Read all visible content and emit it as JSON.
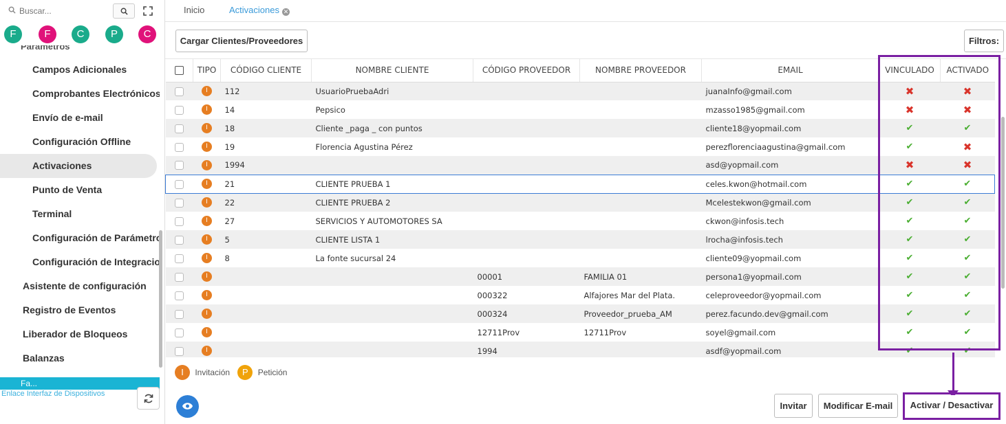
{
  "sidebar": {
    "search_placeholder": "Buscar...",
    "circles": [
      {
        "letter": "F",
        "color": "#1aab8b"
      },
      {
        "letter": "F",
        "color": "#e0127a"
      },
      {
        "letter": "C",
        "color": "#1aab8b"
      },
      {
        "letter": "P",
        "color": "#1aab8b"
      },
      {
        "letter": "C",
        "color": "#e0127a"
      }
    ],
    "section_partial": "Parámetros",
    "items": [
      {
        "label": "Campos Adicionales",
        "level": "sub"
      },
      {
        "label": "Comprobantes Electrónicos",
        "level": "sub"
      },
      {
        "label": "Envío de e-mail",
        "level": "sub"
      },
      {
        "label": "Configuración Offline",
        "level": "sub"
      },
      {
        "label": "Activaciones",
        "level": "sub",
        "active": true
      },
      {
        "label": "Punto de Venta",
        "level": "sub"
      },
      {
        "label": "Terminal",
        "level": "sub"
      },
      {
        "label": "Configuración de Parámetros",
        "level": "sub"
      },
      {
        "label": "Configuración de Integraciones",
        "level": "sub"
      },
      {
        "label": "Asistente de configuración",
        "level": "top"
      },
      {
        "label": "Registro de Eventos",
        "level": "top"
      },
      {
        "label": "Liberador de Bloqueos",
        "level": "top"
      },
      {
        "label": "Balanzas",
        "level": "top"
      }
    ],
    "footer_partial": "Fa...",
    "device_link": "Enlace Interfaz de Dispositivos"
  },
  "tabs": [
    {
      "label": "Inicio"
    },
    {
      "label": "Activaciones",
      "closable": true
    }
  ],
  "toolbar": {
    "cargar_label": "Cargar Clientes/Proveedores",
    "filtros_label": "Filtros:"
  },
  "table": {
    "headers": [
      "",
      "TIPO",
      "CÓDIGO CLIENTE",
      "NOMBRE CLIENTE",
      "CÓDIGO PROVEEDOR",
      "NOMBRE PROVEEDOR",
      "EMAIL",
      "VINCULADO",
      "ACTIVADO"
    ],
    "rows": [
      {
        "tipo": "I",
        "codigo_cliente": "112",
        "nombre_cliente": "UsuarioPruebaAdri",
        "codigo_proveedor": "",
        "nombre_proveedor": "",
        "email": "juanaInfo@gmail.com",
        "vinculado": false,
        "activado": false
      },
      {
        "tipo": "I",
        "codigo_cliente": "14",
        "nombre_cliente": "Pepsico",
        "codigo_proveedor": "",
        "nombre_proveedor": "",
        "email": "mzasso1985@gmail.com",
        "vinculado": false,
        "activado": false
      },
      {
        "tipo": "I",
        "codigo_cliente": "18",
        "nombre_cliente": "Cliente _paga _ con puntos",
        "codigo_proveedor": "",
        "nombre_proveedor": "",
        "email": "cliente18@yopmail.com",
        "vinculado": true,
        "activado": true
      },
      {
        "tipo": "I",
        "codigo_cliente": "19",
        "nombre_cliente": "Florencia Agustina Pérez",
        "codigo_proveedor": "",
        "nombre_proveedor": "",
        "email": "perezflorenciaagustina@gmail.com",
        "vinculado": true,
        "activado": false
      },
      {
        "tipo": "I",
        "codigo_cliente": "1994",
        "nombre_cliente": "",
        "codigo_proveedor": "",
        "nombre_proveedor": "",
        "email": "asd@yopmail.com",
        "vinculado": false,
        "activado": false
      },
      {
        "tipo": "I",
        "codigo_cliente": "21",
        "nombre_cliente": "CLIENTE PRUEBA 1",
        "codigo_proveedor": "",
        "nombre_proveedor": "",
        "email": "celes.kwon@hotmail.com",
        "vinculado": true,
        "activado": true,
        "selected": true
      },
      {
        "tipo": "I",
        "codigo_cliente": "22",
        "nombre_cliente": "CLIENTE PRUEBA 2",
        "codigo_proveedor": "",
        "nombre_proveedor": "",
        "email": "Mcelestekwon@gmail.com",
        "vinculado": true,
        "activado": true
      },
      {
        "tipo": "I",
        "codigo_cliente": "27",
        "nombre_cliente": "SERVICIOS Y AUTOMOTORES SA",
        "codigo_proveedor": "",
        "nombre_proveedor": "",
        "email": "ckwon@infosis.tech",
        "vinculado": true,
        "activado": true
      },
      {
        "tipo": "I",
        "codigo_cliente": "5",
        "nombre_cliente": "CLIENTE LISTA 1",
        "codigo_proveedor": "",
        "nombre_proveedor": "",
        "email": "lrocha@infosis.tech",
        "vinculado": true,
        "activado": true
      },
      {
        "tipo": "I",
        "codigo_cliente": "8",
        "nombre_cliente": "La fonte sucursal 24",
        "codigo_proveedor": "",
        "nombre_proveedor": "",
        "email": "cliente09@yopmail.com",
        "vinculado": true,
        "activado": true
      },
      {
        "tipo": "I",
        "codigo_cliente": "",
        "nombre_cliente": "",
        "codigo_proveedor": "00001",
        "nombre_proveedor": "FAMILIA 01",
        "email": "persona1@yopmail.com",
        "vinculado": true,
        "activado": true
      },
      {
        "tipo": "I",
        "codigo_cliente": "",
        "nombre_cliente": "",
        "codigo_proveedor": "000322",
        "nombre_proveedor": "Alfajores Mar del Plata.",
        "email": "celeproveedor@yopmail.com",
        "vinculado": true,
        "activado": true
      },
      {
        "tipo": "I",
        "codigo_cliente": "",
        "nombre_cliente": "",
        "codigo_proveedor": "000324",
        "nombre_proveedor": "Proveedor_prueba_AM",
        "email": "perez.facundo.dev@gmail.com",
        "vinculado": true,
        "activado": true
      },
      {
        "tipo": "I",
        "codigo_cliente": "",
        "nombre_cliente": "",
        "codigo_proveedor": "12711Prov",
        "nombre_proveedor": "12711Prov",
        "email": "soyel@gmail.com",
        "vinculado": true,
        "activado": true
      },
      {
        "tipo": "I",
        "codigo_cliente": "",
        "nombre_cliente": "",
        "codigo_proveedor": "1994",
        "nombre_proveedor": "",
        "email": "asdf@yopmail.com",
        "vinculado": true,
        "activado": true
      }
    ]
  },
  "legend": {
    "invitacion_letter": "I",
    "invitacion_label": "Invitación",
    "invitacion_color": "#e67e22",
    "peticion_letter": "P",
    "peticion_label": "Petición",
    "peticion_color": "#f0a30a"
  },
  "actions": {
    "invitar_label": "Invitar",
    "modificar_label": "Modificar E-mail",
    "activar_label": "Activar / Desactivar"
  },
  "colors": {
    "highlight": "#7a1fa2",
    "accent": "#3a9ad9",
    "cross": "#d9342b",
    "check": "#4aae31"
  }
}
